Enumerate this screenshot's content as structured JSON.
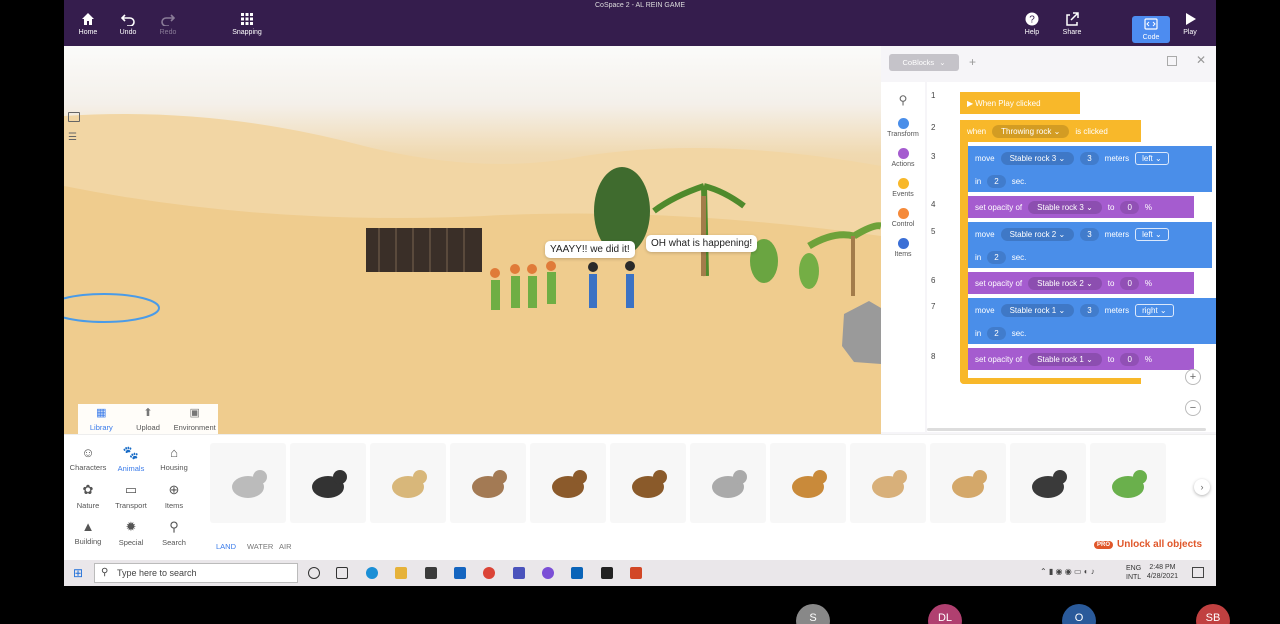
{
  "window": {
    "title": "CoSpace 2 - AL REIN GAME"
  },
  "toolbar": {
    "home": "Home",
    "undo": "Undo",
    "redo": "Redo",
    "snapping": "Snapping",
    "help": "Help",
    "share": "Share",
    "code": "Code",
    "play": "Play"
  },
  "scene": {
    "bubble1": "YAAYY!! we did it!",
    "bubble2": "OH what is happening!",
    "library_tabs": [
      "Library",
      "Upload",
      "Environment"
    ]
  },
  "code_panel": {
    "tab": "CoBlocks",
    "add": "+",
    "categories": [
      {
        "label": "Transform",
        "color": "#4a8ee9"
      },
      {
        "label": "Actions",
        "color": "#a55ccf"
      },
      {
        "label": "Events",
        "color": "#f8b82a"
      },
      {
        "label": "Control",
        "color": "#f58a3a"
      },
      {
        "label": "Items",
        "color": "#3b6fd6"
      }
    ],
    "lines": [
      "1",
      "2",
      "3",
      "4",
      "5",
      "6",
      "7",
      "8"
    ],
    "when_play": "When Play clicked",
    "when": "when",
    "trigger_obj": "Throwing rock",
    "is_clicked": "is clicked",
    "move": "move",
    "meters": "meters",
    "in": "in",
    "sec": "sec.",
    "set_opacity": "set opacity of",
    "to": "to",
    "percent": "%",
    "blocks": [
      {
        "obj": "Stable rock 3",
        "dist": "3",
        "dir": "left",
        "time": "2",
        "opacity": "0"
      },
      {
        "obj": "Stable rock 2",
        "dist": "3",
        "dir": "left",
        "time": "2",
        "opacity": "0"
      },
      {
        "obj": "Stable rock 1",
        "dist": "3",
        "dir": "right",
        "time": "2",
        "opacity": "0"
      }
    ]
  },
  "library": {
    "categories": [
      "Characters",
      "Animals",
      "Housing",
      "Nature",
      "Transport",
      "Items",
      "Building",
      "Special",
      "Search"
    ],
    "subtabs": [
      "LAND",
      "WATER",
      "AIR"
    ],
    "unlock_badge": "PRO",
    "unlock": "Unlock all objects",
    "animals": [
      "mouse",
      "cat",
      "dog",
      "rabbit",
      "horse",
      "bear",
      "elephant",
      "lion",
      "lioness",
      "camel",
      "gorilla",
      "snake"
    ]
  },
  "taskbar": {
    "search_placeholder": "Type here to search",
    "lang": "ENG",
    "lang2": "INTL",
    "time": "2:48 PM",
    "date": "4/28/2021"
  },
  "participants": [
    "S",
    "DL",
    "O",
    "SB"
  ]
}
